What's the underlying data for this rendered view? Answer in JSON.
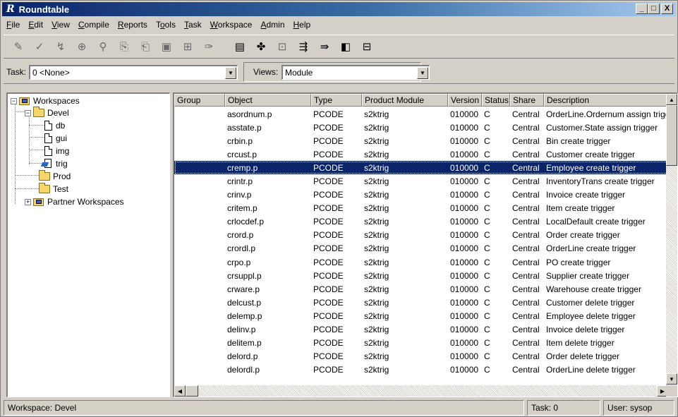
{
  "window": {
    "logo": "R",
    "title": "Roundtable",
    "min_btn": "_",
    "max_btn": "□",
    "close_btn": "X"
  },
  "menu": [
    {
      "pre": "",
      "ul": "F",
      "post": "ile"
    },
    {
      "pre": "",
      "ul": "E",
      "post": "dit"
    },
    {
      "pre": "",
      "ul": "V",
      "post": "iew"
    },
    {
      "pre": "",
      "ul": "C",
      "post": "ompile"
    },
    {
      "pre": "",
      "ul": "R",
      "post": "eports"
    },
    {
      "pre": "T",
      "ul": "o",
      "post": "ols"
    },
    {
      "pre": "",
      "ul": "T",
      "post": "ask"
    },
    {
      "pre": "",
      "ul": "W",
      "post": "orkspace"
    },
    {
      "pre": "",
      "ul": "A",
      "post": "dmin"
    },
    {
      "pre": "",
      "ul": "H",
      "post": "elp"
    }
  ],
  "toolbar": {
    "icons": [
      {
        "name": "checkout-icon",
        "glyph": "✎",
        "active": false
      },
      {
        "name": "checkin-icon",
        "glyph": "✓",
        "active": false
      },
      {
        "name": "assign-icon",
        "glyph": "↯",
        "active": false
      },
      {
        "name": "inspect-icon",
        "glyph": "⊕",
        "active": false
      },
      {
        "name": "find-icon",
        "glyph": "⚲",
        "active": false
      },
      {
        "name": "copy-icon",
        "glyph": "⎘",
        "active": false
      },
      {
        "name": "paste-icon",
        "glyph": "⎗",
        "active": false
      },
      {
        "name": "compile-icon",
        "glyph": "▣",
        "active": false
      },
      {
        "name": "xref-icon",
        "glyph": "⊞",
        "active": false
      },
      {
        "name": "annotate-icon",
        "glyph": "✑",
        "active": false
      },
      {
        "name": "report-icon",
        "glyph": "▤",
        "active": true
      },
      {
        "name": "deploy-icon",
        "glyph": "✤",
        "active": true
      },
      {
        "name": "schema-icon",
        "glyph": "⊡",
        "active": false
      },
      {
        "name": "import-icon",
        "glyph": "⇶",
        "active": true
      },
      {
        "name": "export-icon",
        "glyph": "⇛",
        "active": true
      },
      {
        "name": "package-icon",
        "glyph": "◧",
        "active": true
      },
      {
        "name": "browse-icon",
        "glyph": "⊟",
        "active": true
      }
    ]
  },
  "task": {
    "label": "Task:",
    "value": "0 <None>"
  },
  "views": {
    "label": "Views:",
    "value": "Module"
  },
  "tree": {
    "root": "Workspaces",
    "devel": "Devel",
    "db": "db",
    "gui": "gui",
    "img": "img",
    "trig": "trig",
    "prod": "Prod",
    "test": "Test",
    "partner": "Partner Workspaces",
    "expand_minus": "−",
    "expand_plus": "+"
  },
  "grid": {
    "columns": [
      "Group",
      "Object",
      "Type",
      "Product Module",
      "Version",
      "Status",
      "Share",
      "Description"
    ],
    "rows": [
      {
        "group": "",
        "object": "asordnum.p",
        "type": "PCODE",
        "module": "s2ktrig",
        "version": "010000",
        "status": "C",
        "share": "Central",
        "description": "OrderLine.Ordernum assign trigg",
        "selected": false
      },
      {
        "group": "",
        "object": "asstate.p",
        "type": "PCODE",
        "module": "s2ktrig",
        "version": "010000",
        "status": "C",
        "share": "Central",
        "description": "Customer.State assign trigger",
        "selected": false
      },
      {
        "group": "",
        "object": "crbin.p",
        "type": "PCODE",
        "module": "s2ktrig",
        "version": "010000",
        "status": "C",
        "share": "Central",
        "description": "Bin create trigger",
        "selected": false
      },
      {
        "group": "",
        "object": "crcust.p",
        "type": "PCODE",
        "module": "s2ktrig",
        "version": "010000",
        "status": "C",
        "share": "Central",
        "description": "Customer create trigger",
        "selected": false
      },
      {
        "group": "",
        "object": "cremp.p",
        "type": "PCODE",
        "module": "s2ktrig",
        "version": "010000",
        "status": "C",
        "share": "Central",
        "description": "Employee create trigger",
        "selected": true
      },
      {
        "group": "",
        "object": "crintr.p",
        "type": "PCODE",
        "module": "s2ktrig",
        "version": "010000",
        "status": "C",
        "share": "Central",
        "description": "InventoryTrans create trigger",
        "selected": false
      },
      {
        "group": "",
        "object": "crinv.p",
        "type": "PCODE",
        "module": "s2ktrig",
        "version": "010000",
        "status": "C",
        "share": "Central",
        "description": "Invoice create trigger",
        "selected": false
      },
      {
        "group": "",
        "object": "critem.p",
        "type": "PCODE",
        "module": "s2ktrig",
        "version": "010000",
        "status": "C",
        "share": "Central",
        "description": "Item create trigger",
        "selected": false
      },
      {
        "group": "",
        "object": "crlocdef.p",
        "type": "PCODE",
        "module": "s2ktrig",
        "version": "010000",
        "status": "C",
        "share": "Central",
        "description": "LocalDefault create trigger",
        "selected": false
      },
      {
        "group": "",
        "object": "crord.p",
        "type": "PCODE",
        "module": "s2ktrig",
        "version": "010000",
        "status": "C",
        "share": "Central",
        "description": "Order create trigger",
        "selected": false
      },
      {
        "group": "",
        "object": "crordl.p",
        "type": "PCODE",
        "module": "s2ktrig",
        "version": "010000",
        "status": "C",
        "share": "Central",
        "description": "OrderLine create trigger",
        "selected": false
      },
      {
        "group": "",
        "object": "crpo.p",
        "type": "PCODE",
        "module": "s2ktrig",
        "version": "010000",
        "status": "C",
        "share": "Central",
        "description": "PO create trigger",
        "selected": false
      },
      {
        "group": "",
        "object": "crsuppl.p",
        "type": "PCODE",
        "module": "s2ktrig",
        "version": "010000",
        "status": "C",
        "share": "Central",
        "description": "Supplier create trigger",
        "selected": false
      },
      {
        "group": "",
        "object": "crware.p",
        "type": "PCODE",
        "module": "s2ktrig",
        "version": "010000",
        "status": "C",
        "share": "Central",
        "description": "Warehouse create trigger",
        "selected": false
      },
      {
        "group": "",
        "object": "delcust.p",
        "type": "PCODE",
        "module": "s2ktrig",
        "version": "010000",
        "status": "C",
        "share": "Central",
        "description": "Customer delete trigger",
        "selected": false
      },
      {
        "group": "",
        "object": "delemp.p",
        "type": "PCODE",
        "module": "s2ktrig",
        "version": "010000",
        "status": "C",
        "share": "Central",
        "description": "Employee delete trigger",
        "selected": false
      },
      {
        "group": "",
        "object": "delinv.p",
        "type": "PCODE",
        "module": "s2ktrig",
        "version": "010000",
        "status": "C",
        "share": "Central",
        "description": "Invoice delete trigger",
        "selected": false
      },
      {
        "group": "",
        "object": "delitem.p",
        "type": "PCODE",
        "module": "s2ktrig",
        "version": "010000",
        "status": "C",
        "share": "Central",
        "description": "Item delete trigger",
        "selected": false
      },
      {
        "group": "",
        "object": "delord.p",
        "type": "PCODE",
        "module": "s2ktrig",
        "version": "010000",
        "status": "C",
        "share": "Central",
        "description": "Order delete trigger",
        "selected": false
      },
      {
        "group": "",
        "object": "delordl.p",
        "type": "PCODE",
        "module": "s2ktrig",
        "version": "010000",
        "status": "C",
        "share": "Central",
        "description": "OrderLine delete trigger",
        "selected": false
      }
    ],
    "scroll_up": "▲",
    "scroll_down": "▼",
    "scroll_left": "◀",
    "scroll_right": "▶"
  },
  "statusbar": {
    "workspace": "Workspace: Devel",
    "task": "Task: 0",
    "user": "User: sysop"
  },
  "colors": {
    "selection": "#0a246a",
    "title_start": "#0a246a",
    "title_end": "#a6caf0"
  }
}
